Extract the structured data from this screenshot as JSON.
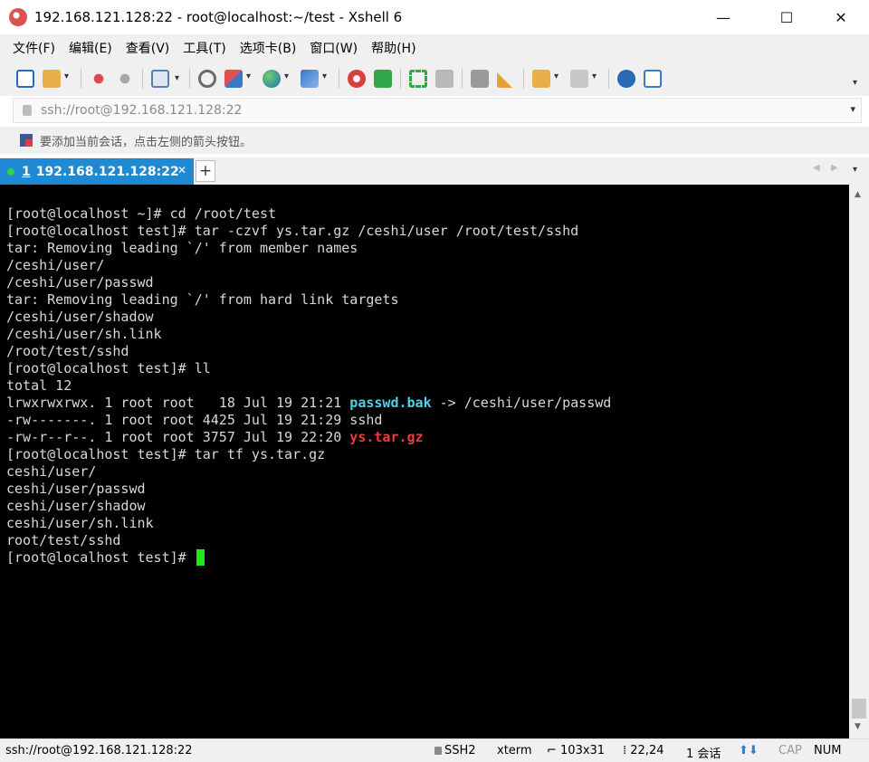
{
  "window": {
    "title": "192.168.121.128:22 - root@localhost:~/test - Xshell 6",
    "minimize_glyph": "—",
    "maximize_glyph": "☐",
    "close_glyph": "✕"
  },
  "menu": [
    "文件(F)",
    "编辑(E)",
    "查看(V)",
    "工具(T)",
    "选项卡(B)",
    "窗口(W)",
    "帮助(H)"
  ],
  "toolbar": {
    "icons": [
      "new-session-icon",
      "open-folder-icon",
      "connect-icon",
      "disconnect-icon",
      "properties-icon",
      "find-icon",
      "transfer-icon",
      "globe-icon",
      "font-icon",
      "xftp-icon",
      "xmanager-icon",
      "fullscreen-icon",
      "lock-icon",
      "keyboard-icon",
      "highlight-icon",
      "compose-icon",
      "layout-icon",
      "help-icon",
      "chat-icon"
    ]
  },
  "address": {
    "value": "ssh://root@192.168.121.128:22"
  },
  "hint": {
    "text": "要添加当前会话，点击左侧的箭头按钮。"
  },
  "tabs": {
    "active_number": "1",
    "active_label": "192.168.121.128:22",
    "close_glyph": "✕",
    "add_glyph": "+"
  },
  "terminal": {
    "lines": [
      "[root@localhost ~]# cd /root/test",
      "[root@localhost test]# tar -czvf ys.tar.gz /ceshi/user /root/test/sshd",
      "tar: Removing leading `/' from member names",
      "/ceshi/user/",
      "/ceshi/user/passwd",
      "tar: Removing leading `/' from hard link targets",
      "/ceshi/user/shadow",
      "/ceshi/user/sh.link",
      "/root/test/sshd",
      "[root@localhost test]# ll",
      "total 12"
    ],
    "ls_rows": [
      {
        "prefix": "lrwxrwxrwx. 1 root root   18 Jul 19 21:21 ",
        "name": "passwd.bak",
        "suffix": " -> /ceshi/user/passwd"
      },
      {
        "prefix": "-rw-------. 1 root root 4425 Jul 19 21:29 ",
        "name": "sshd",
        "suffix": ""
      },
      {
        "prefix": "-rw-r--r--. 1 root root 3757 Jul 19 22:20 ",
        "name": "ys.tar.gz",
        "suffix": ""
      }
    ],
    "tail_lines": [
      "[root@localhost test]# tar tf ys.tar.gz",
      "ceshi/user/",
      "ceshi/user/passwd",
      "ceshi/user/shadow",
      "ceshi/user/sh.link",
      "root/test/sshd"
    ],
    "prompt": "[root@localhost test]# ",
    "colors": {
      "background": "#000000",
      "text": "#d8d8d8",
      "symlink": "#4fd2e8",
      "archive": "#ef3b3b",
      "cursor": "#1ee81e"
    }
  },
  "status": {
    "connection": "ssh://root@192.168.121.128:22",
    "protocol": "SSH2",
    "term": "xterm",
    "size": "103x31",
    "cursor_pos": "22,24",
    "sessions": "1 会话",
    "cap": "CAP",
    "num": "NUM"
  }
}
